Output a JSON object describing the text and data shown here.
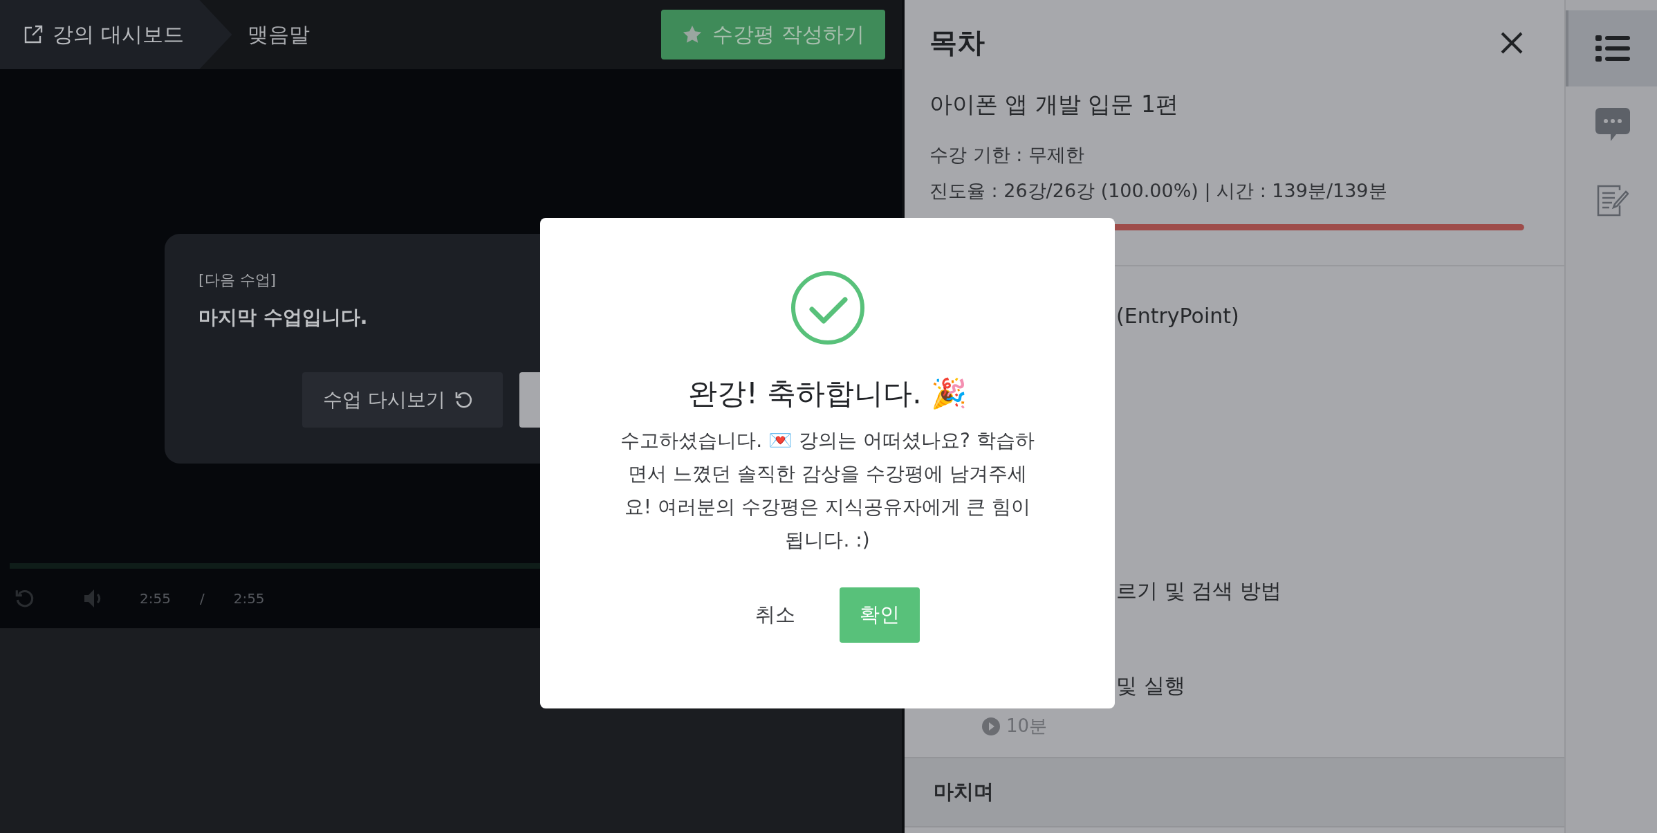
{
  "top_bar": {
    "breadcrumbs": [
      {
        "label": "강의 대시보드",
        "kind": "link"
      },
      {
        "label": "맺음말",
        "kind": "current"
      }
    ],
    "review_button": "수강평 작성하기"
  },
  "next_lesson_card": {
    "caption": "[다음 수업]",
    "title": "마지막 수업입니다.",
    "buttons": [
      {
        "label": "수업 다시보기",
        "kind": "replay"
      },
      {
        "kind": "next"
      }
    ]
  },
  "player": {
    "progress": {
      "level": 1
    },
    "current_time": "2:55",
    "separator": "/",
    "duration": "2:55"
  },
  "toc": {
    "title": "목차",
    "course_title": "아이폰 앱 개발 입문 1편",
    "period": "수강 기한 : 무제한",
    "progress_text": "진도율 : 26강/26강 (100.00%) | 시간 : 139분/139분",
    "progress": {
      "level": 1
    },
    "items": [
      {
        "title": "(EntryPoint)"
      },
      {
        "title": "르기 및 검색 방법"
      },
      {
        "title": "및 실행",
        "duration": "10분"
      }
    ],
    "sections": [
      {
        "title": "마치며"
      }
    ]
  },
  "rail": [
    {
      "kind": "list",
      "selected": true
    },
    {
      "kind": "chat",
      "selected": false
    },
    {
      "kind": "note",
      "selected": false
    }
  ],
  "dialog": {
    "title": "완강! 축하합니다. 🎉",
    "message": "수고하셨습니다. 💌 강의는 어떠셨나요? 학습하면서 느꼈던 솔직한 감상을 수강평에 남겨주세요! 여러분의 수강평은 지식공유자에게 큰 힘이 됩니다. :)",
    "buttons": [
      {
        "label": "취소",
        "kind": "secondary"
      },
      {
        "label": "확인",
        "kind": "primary"
      }
    ]
  }
}
